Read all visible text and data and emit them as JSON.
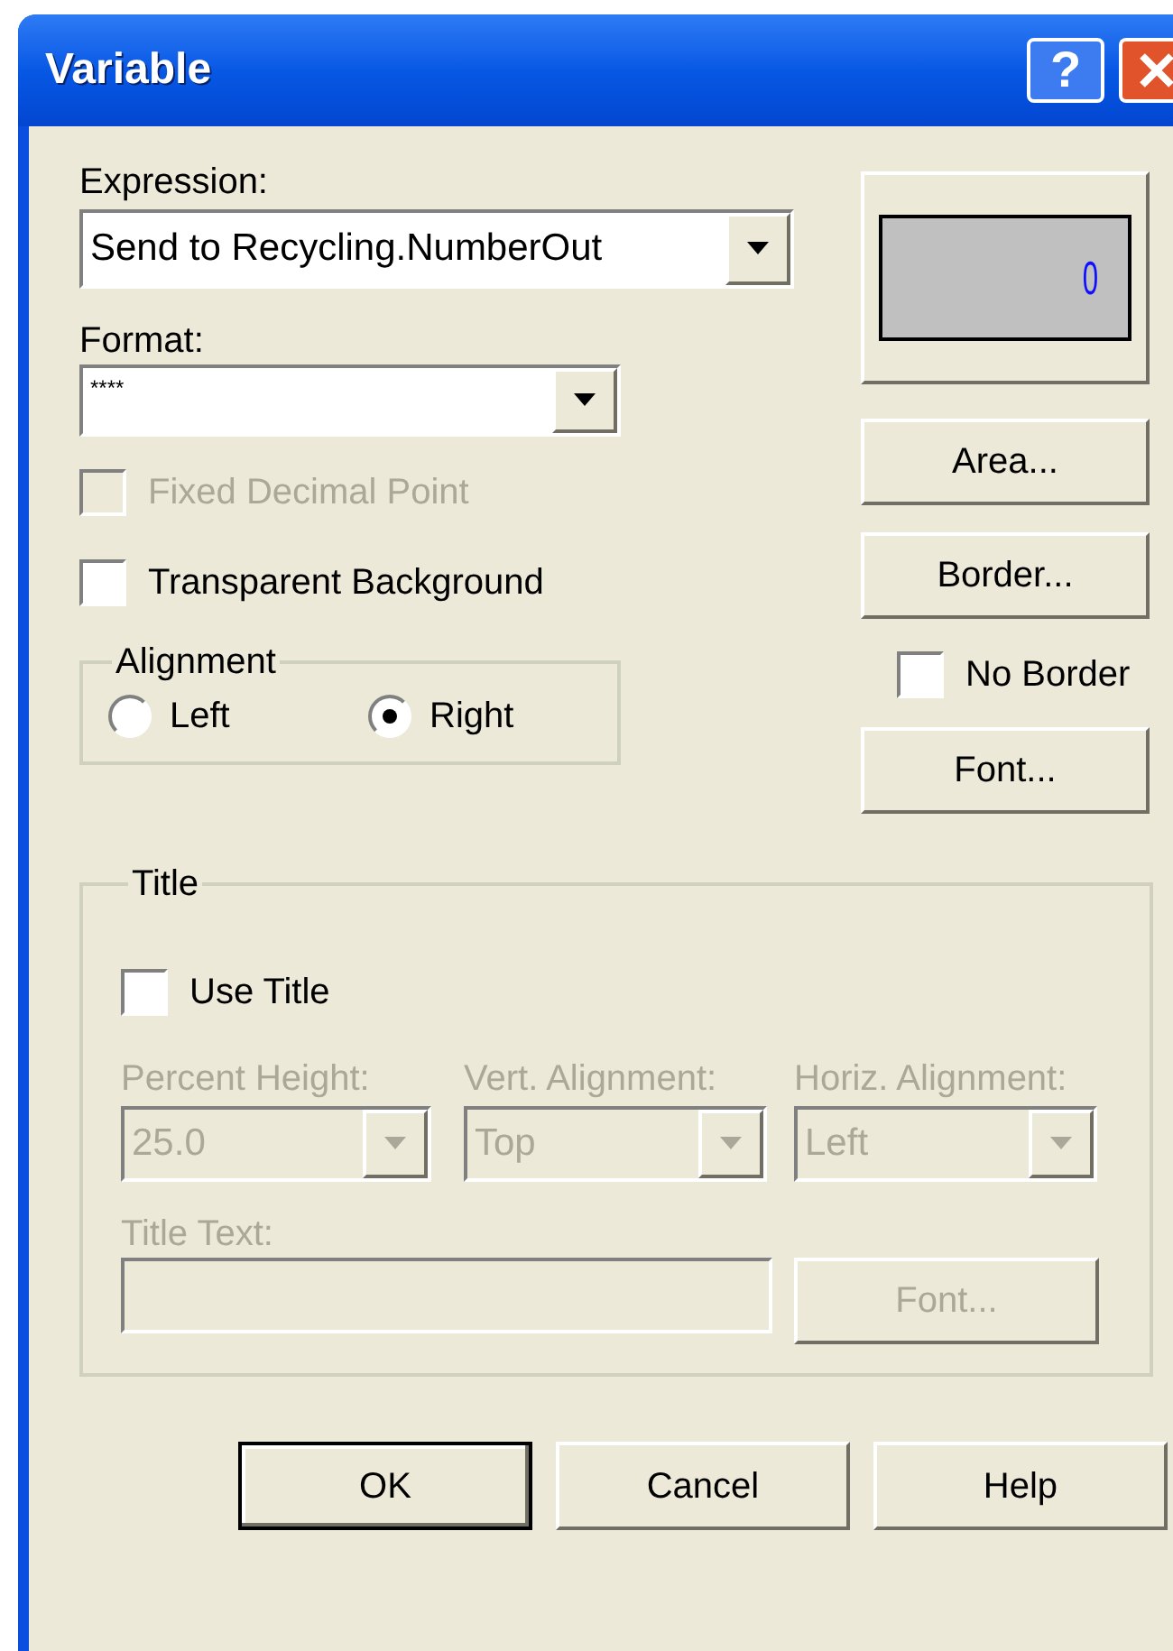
{
  "window": {
    "title": "Variable",
    "help_button": "?"
  },
  "expression": {
    "label": "Expression:",
    "value": "Send to Recycling.NumberOut"
  },
  "preview": {
    "value": "0"
  },
  "format": {
    "label": "Format:",
    "value": "****"
  },
  "checkboxes": [
    {
      "label": "Fixed Decimal Point",
      "checked": false,
      "disabled": true
    },
    {
      "label": "Transparent Background",
      "checked": false,
      "disabled": false
    }
  ],
  "alignment": {
    "label": "Alignment",
    "options": [
      {
        "label": "Left",
        "selected": false
      },
      {
        "label": "Right",
        "selected": true
      }
    ]
  },
  "side_buttons": [
    "Area...",
    "Border..."
  ],
  "no_border": {
    "label": "No Border",
    "checked": false
  },
  "font_button": "Font...",
  "title_group": {
    "label": "Title",
    "use_title": {
      "label": "Use Title",
      "checked": false
    },
    "disabled": true,
    "fields": [
      {
        "label": "Percent Height:",
        "value": "25.0"
      },
      {
        "label": "Vert. Alignment:",
        "value": "Top"
      },
      {
        "label": "Horiz. Alignment:",
        "value": "Left"
      }
    ],
    "title_text": {
      "label": "Title Text:"
    },
    "font_button": "Font..."
  },
  "buttons": [
    {
      "label": "OK",
      "default": true
    },
    {
      "label": "Cancel",
      "default": false
    },
    {
      "label": "Help",
      "default": false
    }
  ]
}
